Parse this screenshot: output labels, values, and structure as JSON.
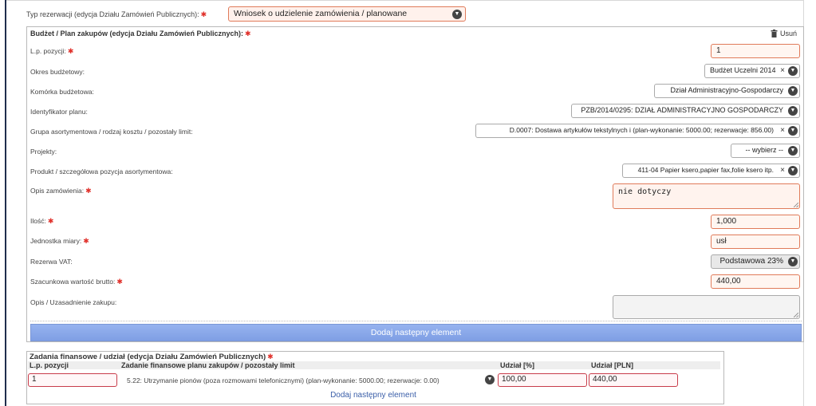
{
  "form": {
    "typ_label": "Typ rezerwacji (edycja Działu Zamówień Publicznych):",
    "typ_value": "Wniosek o udzielenie zamówienia / planowane"
  },
  "budget": {
    "title": "Budżet / Plan zakupów (edycja Działu Zamówień Publicznych):",
    "remove_label": "Usuń",
    "rows": {
      "lp_label": "L.p. pozycji:",
      "lp_value": "1",
      "okres_label": "Okres budżetowy:",
      "okres_value": "Budżet Uczelni 2014",
      "komorka_label": "Komórka budżetowa:",
      "komorka_value": "Dział Administracyjno-Gospodarczy",
      "identyfikator_label": "Identyfikator planu:",
      "identyfikator_value": "PZB/2014/0295: DZIAŁ ADMINISTRACYJNO GOSPODARCZY",
      "grupa_label": "Grupa asortymentowa / rodzaj kosztu / pozostały limit:",
      "grupa_value": "D.0007: Dostawa artykułów tekstylnych i (plan-wykonanie: 5000.00; rezerwacje: 856.00)",
      "projekty_label": "Projekty:",
      "projekty_value": "-- wybierz --",
      "produkt_label": "Produkt / szczegółowa pozycja asortymentowa:",
      "produkt_value": "411-04 Papier ksero,papier fax,folie ksero itp.",
      "opis_label": "Opis zamówienia:",
      "opis_value": "nie dotyczy",
      "ilosc_label": "Ilość:",
      "ilosc_value": "1,000",
      "jednostka_label": "Jednostka miary:",
      "jednostka_value": "usł",
      "vat_label": "Rezerwa VAT:",
      "vat_value": "Podstawowa 23%",
      "wartosc_label": "Szacunkowa wartość brutto:",
      "wartosc_value": "440,00",
      "uzasadnienie_label": "Opis / Uzasadnienie zakupu:",
      "uzasadnienie_value": ""
    },
    "add_button": "Dodaj następny element"
  },
  "tasks": {
    "title": "Zadania finansowe / udział (edycja Działu Zamówień Publicznych)",
    "col_lp": "L.p. pozycji",
    "col_zadanie": "Zadanie finansowe planu zakupów / pozostały limit",
    "col_udzial_pct": "Udział [%]",
    "col_udzial_pln": "Udział [PLN]",
    "row_lp": "1",
    "row_zadanie": "5.22: Utrzymanie pionów (poza rozmowami telefonicznymi) (plan-wykonanie: 5000.00; rezerwacje: 0.00)",
    "row_pct": "100,00",
    "row_pln": "440,00",
    "add_link": "Dodaj następny element"
  }
}
